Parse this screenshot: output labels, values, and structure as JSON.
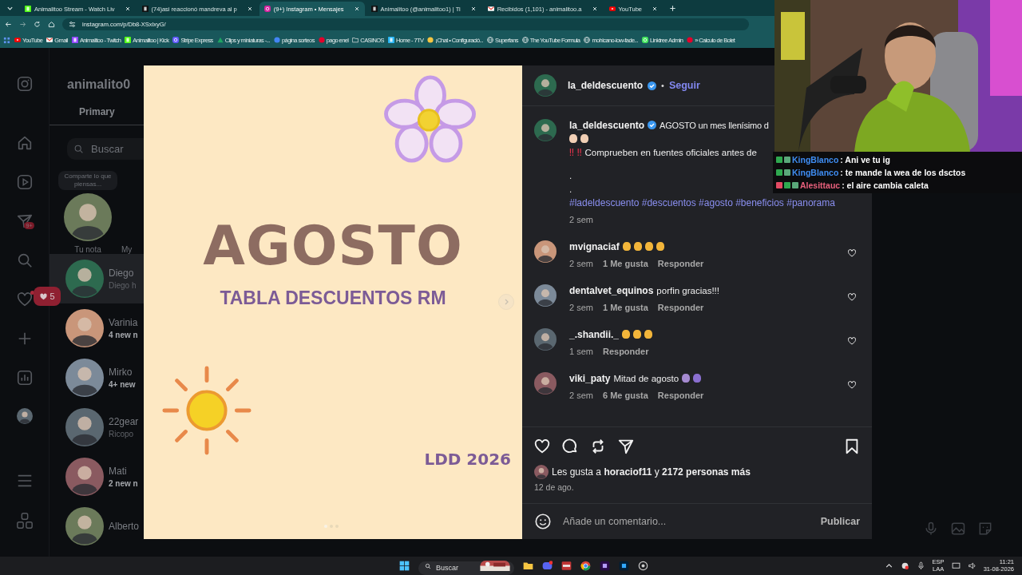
{
  "browser": {
    "tabs": [
      {
        "kind": "kick",
        "title": "Animalitoo Stream - Watch Liv",
        "selected": false
      },
      {
        "kind": "tiktok",
        "title": "(74)asi reaccionó mandreva al p",
        "selected": false
      },
      {
        "kind": "instagram",
        "title": "(9+) Instagram • Mensajes",
        "selected": true
      },
      {
        "kind": "tiktok",
        "title": "Animalitoo (@animalitoo1) | Ti",
        "selected": false
      },
      {
        "kind": "gmail",
        "title": "Recibidos (1,101) - animalitoo.a",
        "selected": false
      },
      {
        "kind": "youtube",
        "title": "YouTube",
        "selected": false
      }
    ],
    "address": "instagram.com/p/Db8-XSxlxyG/",
    "bookmarks": [
      {
        "kind": "youtube",
        "label": "YouTube"
      },
      {
        "kind": "gmail",
        "label": "Gmail"
      },
      {
        "kind": "twitch",
        "label": "Animalitoo - Twitch"
      },
      {
        "kind": "kick",
        "label": "Animalitoo | Kick"
      },
      {
        "kind": "stripe",
        "label": "Stripe Express"
      },
      {
        "kind": "drive",
        "label": "Clips y miniaturas -..."
      },
      {
        "kind": "google",
        "label": "página sorteos"
      },
      {
        "kind": "enel",
        "label": "pago enel"
      },
      {
        "kind": "folder",
        "label": "CASINOS"
      },
      {
        "kind": "seventv",
        "label": "Home - 7TV"
      },
      {
        "kind": "chat",
        "label": "¡Chat • Configuració..."
      },
      {
        "kind": "globe",
        "label": "Superfans"
      },
      {
        "kind": "globe",
        "label": "The YouTube Formula"
      },
      {
        "kind": "globe",
        "label": "mohicano-low-fade..."
      },
      {
        "kind": "linktree",
        "label": "Linktree Admin"
      },
      {
        "kind": "enel",
        "label": "» Calculo de Bolet"
      }
    ]
  },
  "sidebar": {
    "messages_badge": "9+",
    "notification_count": "5"
  },
  "inbox": {
    "username": "animalito0",
    "tab": "Primary",
    "search_placeholder": "Buscar",
    "note_prompt": "Comparte lo que piensas...",
    "notes": [
      "Tu nota",
      "My"
    ],
    "conversations": [
      {
        "name": "Diego",
        "preview": "Diego h",
        "selected": true,
        "unread": false
      },
      {
        "name": "Varinia",
        "preview": "4 new n",
        "selected": false,
        "unread": true
      },
      {
        "name": "Mirko",
        "preview": "4+ new",
        "selected": false,
        "unread": true
      },
      {
        "name": "22gear",
        "preview": "Ricopo",
        "selected": false,
        "unread": false
      },
      {
        "name": "Mati",
        "preview": "2 new n",
        "selected": false,
        "unread": true
      },
      {
        "name": "Alberto",
        "selected": false
      }
    ]
  },
  "post": {
    "image": {
      "title": "AGOSTO",
      "subtitle": "TABLA DESCUENTOS RM",
      "footer": "LDD 2026"
    },
    "author": "la_deldescuento",
    "verified": true,
    "separator": "•",
    "follow": "Seguir",
    "caption": {
      "author": "la_deldescuento",
      "text": "AGOSTO un mes llenísimo d",
      "lines": [
        {
          "kind": "emoji",
          "emojis": [
            {
              "kind": "wave"
            },
            {
              "kind": "wave"
            }
          ]
        },
        {
          "kind": "alert",
          "marks": "‼ ‼",
          "text": "Comprueben en fuentes oficiales antes de"
        },
        {
          "kind": "text",
          "text": "."
        },
        {
          "kind": "text",
          "text": "."
        },
        {
          "kind": "tags",
          "text": "#ladeldescuento #descuentos #agosto #beneficios #panorama"
        }
      ],
      "time": "2 sem"
    },
    "comments": [
      {
        "user": "mvignaciaf",
        "emojis": [
          {
            "kind": "clap"
          },
          {
            "kind": "clap"
          },
          {
            "kind": "clap"
          },
          {
            "kind": "clap"
          }
        ],
        "time": "2 sem",
        "likes": "1 Me gusta",
        "reply": "Responder"
      },
      {
        "user": "dentalvet_equinos",
        "text": "porfin gracias!!!",
        "time": "2 sem",
        "likes": "1 Me gusta",
        "reply": "Responder"
      },
      {
        "user": "_.shandii._",
        "emojis": [
          {
            "kind": "clap"
          },
          {
            "kind": "clap"
          },
          {
            "kind": "clap"
          }
        ],
        "time": "1 sem",
        "reply": "Responder"
      },
      {
        "user": "viki_paty",
        "text": "Mitad de agosto",
        "emojis": [
          {
            "kind": "person"
          },
          {
            "kind": "raise"
          }
        ],
        "time": "2 sem",
        "likes": "6 Me gusta",
        "reply": "Responder"
      }
    ],
    "likes": "Les gusta a **horaciof11** y **2172 personas más**",
    "date": "12 de ago.",
    "comment_field": {
      "placeholder": "Añade un comentario..."
    },
    "publish": "Publicar"
  },
  "chat": [
    {
      "user": "KingBlanco",
      "color": "#3f8df2",
      "text": ": Ani ve tu ig",
      "badges": [
        {
          "kind": "sub"
        },
        {
          "kind": "leaf"
        }
      ]
    },
    {
      "user": "KingBlanco",
      "color": "#3f8df2",
      "text": ": te mande la wea de los dsctos",
      "badges": [
        {
          "kind": "sub"
        },
        {
          "kind": "leaf"
        }
      ]
    },
    {
      "user": "Alesittauc",
      "color": "#e8607c",
      "text": ": el aire cambia caleta",
      "badges": [
        {
          "kind": "heart"
        },
        {
          "kind": "sub"
        },
        {
          "kind": "leaf"
        }
      ]
    }
  ],
  "taskbar": {
    "search_placeholder": "Buscar",
    "language": "ESP",
    "region": "LAA",
    "time": "11:21",
    "date": "31-08-2026"
  }
}
